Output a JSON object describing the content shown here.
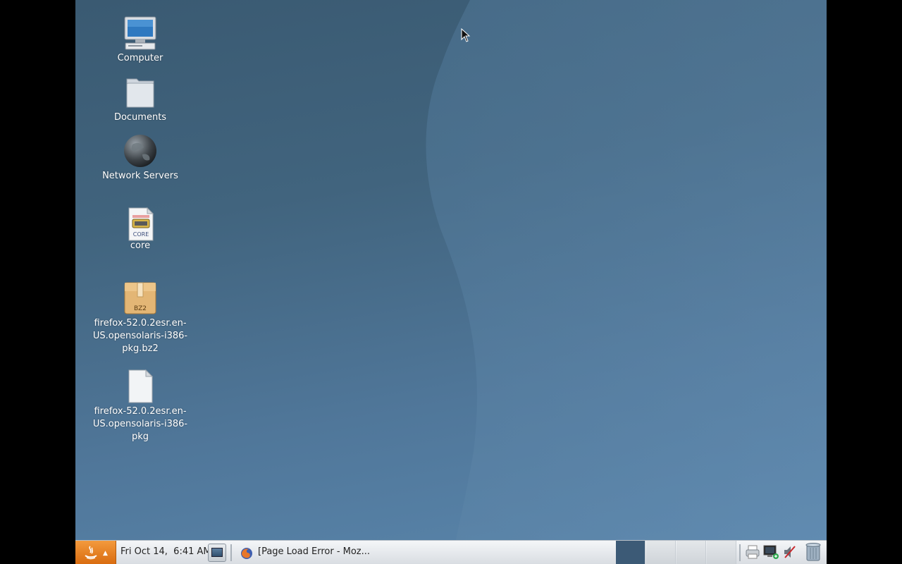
{
  "desktop": {
    "icons": [
      {
        "label": "Computer",
        "icon": "computer-icon"
      },
      {
        "label": "Documents",
        "icon": "folder-icon"
      },
      {
        "label": "Network Servers",
        "icon": "globe-icon"
      },
      {
        "label": "core",
        "icon": "core-file-icon"
      },
      {
        "label": "firefox-52.0.2esr.en-US.opensolaris-i386-pkg.bz2",
        "icon": "bz2-archive-icon"
      },
      {
        "label": "firefox-52.0.2esr.en-US.opensolaris-i386-pkg",
        "icon": "document-file-icon"
      }
    ],
    "icon_labels_lines": {
      "archive": [
        "firefox-52.0.2esr.en-",
        "US.opensolaris-i386-",
        "pkg.bz2"
      ],
      "pkg": [
        "firefox-52.0.2esr.en-",
        "US.opensolaris-i386-",
        "pkg"
      ]
    },
    "archive_badge": "BZ2",
    "core_badge": "CORE"
  },
  "taskbar": {
    "clock": "Fri Oct 14,  6:41 AM",
    "task": "[Page Load Error - Moz...",
    "workspaces": 4,
    "active_workspace": 1
  },
  "colors": {
    "desktop_top": "#3a5a72",
    "desktop_bottom": "#5985ab",
    "start_button": "#e57a20",
    "active_workspace": "#3c5a76"
  }
}
